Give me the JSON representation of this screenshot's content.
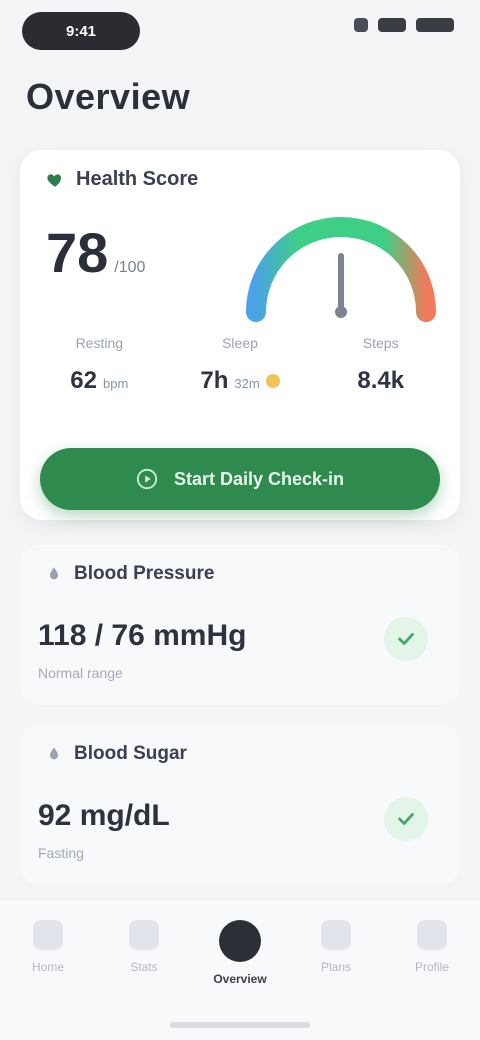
{
  "status_bar": {
    "time": "9:41"
  },
  "page": {
    "title": "Overview"
  },
  "score_card": {
    "header": "Health Score",
    "score": "78",
    "unit": "/100",
    "metrics": [
      {
        "label": "Resting",
        "value": "62",
        "unit": "bpm"
      },
      {
        "label": "Sleep",
        "value": "7h",
        "unit": "32m"
      },
      {
        "label": "Steps",
        "value": "8.4k",
        "unit": ""
      }
    ],
    "button_label": "Start Daily Check-in",
    "colors": {
      "accent": "#2f8a4e",
      "gauge_start": "#4aa3e8",
      "gauge_mid": "#3ecf86",
      "gauge_end": "#f07a5a"
    }
  },
  "cards": [
    {
      "title": "Blood Pressure",
      "value": "118 / 76 mmHg",
      "sub": "Normal range"
    },
    {
      "title": "Blood Sugar",
      "value": "92 mg/dL",
      "sub": "Fasting"
    }
  ],
  "nav": {
    "items": [
      {
        "label": "Home",
        "icon": "home-icon"
      },
      {
        "label": "Stats",
        "icon": "stats-icon"
      },
      {
        "label": "Overview",
        "icon": "overview-icon",
        "active": true
      },
      {
        "label": "Plans",
        "icon": "plans-icon"
      },
      {
        "label": "Profile",
        "icon": "profile-icon"
      }
    ]
  }
}
